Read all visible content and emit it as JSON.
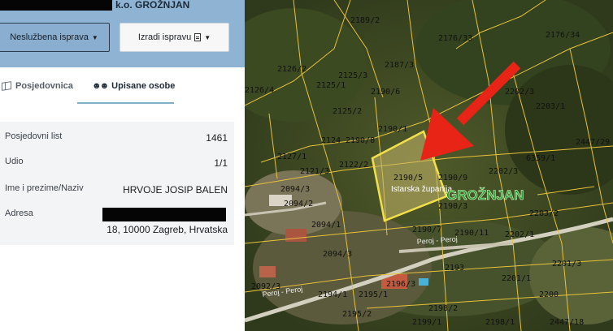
{
  "header": {
    "title": "k.o. GROŽNJAN",
    "official_button": "Neslužbena isprava",
    "create_button": "Izradi ispravu"
  },
  "tabs": [
    {
      "label": "Posjedovnica"
    },
    {
      "label": "Upisane osobe"
    }
  ],
  "details": {
    "rows": [
      {
        "key": "Posjedovni list",
        "value": "1461"
      },
      {
        "key": "Udio",
        "value": "1/1"
      },
      {
        "key": "Ime i prezime/Naziv",
        "value": "HRVOJE JOSIP BALEN"
      },
      {
        "key": "Adresa",
        "value": "18, 10000 Zagreb, Hrvatska"
      }
    ]
  },
  "map": {
    "town_label": "GROŽNJAN",
    "region_label": "Istarska županija",
    "road_labels": [
      "Peroj - Peroj",
      "Peroj - Peroj"
    ],
    "highlight_color": "#f2e04a",
    "parcel_line_color": "#e8c23a",
    "arrow_color": "#e82416",
    "parcels": [
      "2189/2",
      "2176/33",
      "2176/34",
      "2126/2",
      "2187/3",
      "2125/3",
      "2125/1",
      "2190/6",
      "2202/3",
      "2203/1",
      "2125/2",
      "2126/4",
      "2190/1",
      "2124",
      "2190/8",
      "2447/29",
      "6359/1",
      "2127/1",
      "2122/2",
      "2121/3",
      "2190/5",
      "2190/9",
      "2202/3",
      "2094/3",
      "2094/2",
      "2190/3",
      "2203/2",
      "2094/1",
      "2190/7",
      "2190/11",
      "2202/1",
      "2094/3",
      "2193",
      "2201/3",
      "2201/1",
      "2092/3",
      "2194/1",
      "2195/1",
      "2196/3",
      "2200",
      "2195/2",
      "2198/2",
      "2198/1",
      "2199/1",
      "2447/18"
    ]
  }
}
